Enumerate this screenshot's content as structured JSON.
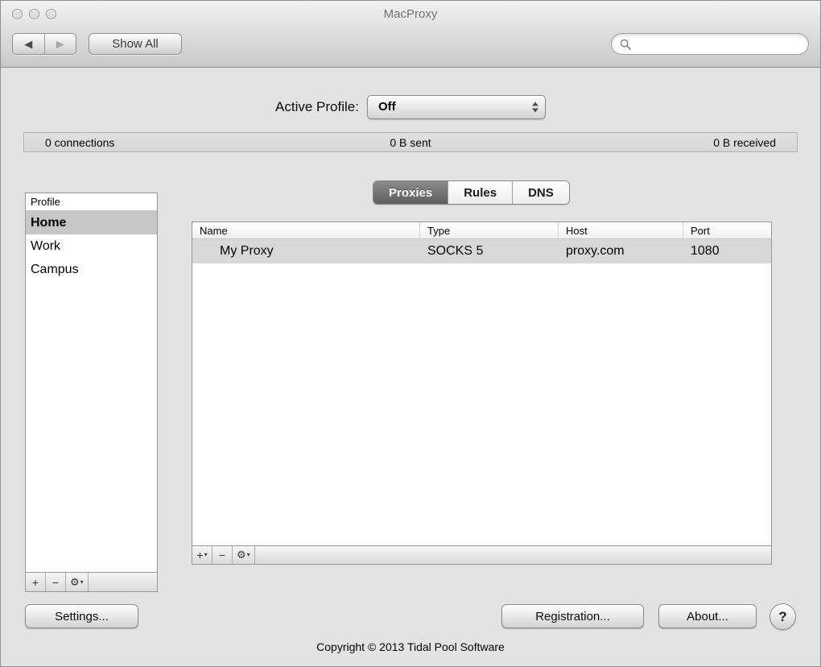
{
  "window": {
    "title": "MacProxy"
  },
  "toolbar": {
    "back_icon": "◀",
    "forward_icon": "▶",
    "show_all_label": "Show All",
    "search_placeholder": ""
  },
  "active_profile": {
    "label": "Active Profile:",
    "value": "Off"
  },
  "status_bar": {
    "connections": "0 connections",
    "sent": "0 B sent",
    "received": "0 B received"
  },
  "profiles": {
    "header": "Profile",
    "items": [
      {
        "name": "Home",
        "selected": true
      },
      {
        "name": "Work",
        "selected": false
      },
      {
        "name": "Campus",
        "selected": false
      }
    ],
    "controls": {
      "add": "+",
      "remove": "−",
      "gear": "⚙",
      "arrow": "▾"
    }
  },
  "tabs": [
    {
      "label": "Proxies",
      "selected": true
    },
    {
      "label": "Rules",
      "selected": false
    },
    {
      "label": "DNS",
      "selected": false
    }
  ],
  "proxy_table": {
    "columns": [
      "Name",
      "Type",
      "Host",
      "Port"
    ],
    "rows": [
      {
        "name": "My Proxy",
        "type": "SOCKS 5",
        "host": "proxy.com",
        "port": "1080",
        "selected": true
      }
    ],
    "controls": {
      "add": "+",
      "add_arrow": "▾",
      "remove": "−",
      "gear": "⚙",
      "gear_arrow": "▾"
    }
  },
  "footer": {
    "settings_label": "Settings...",
    "registration_label": "Registration...",
    "about_label": "About...",
    "help_label": "?",
    "copyright": "Copyright © 2013 Tidal Pool Software"
  }
}
